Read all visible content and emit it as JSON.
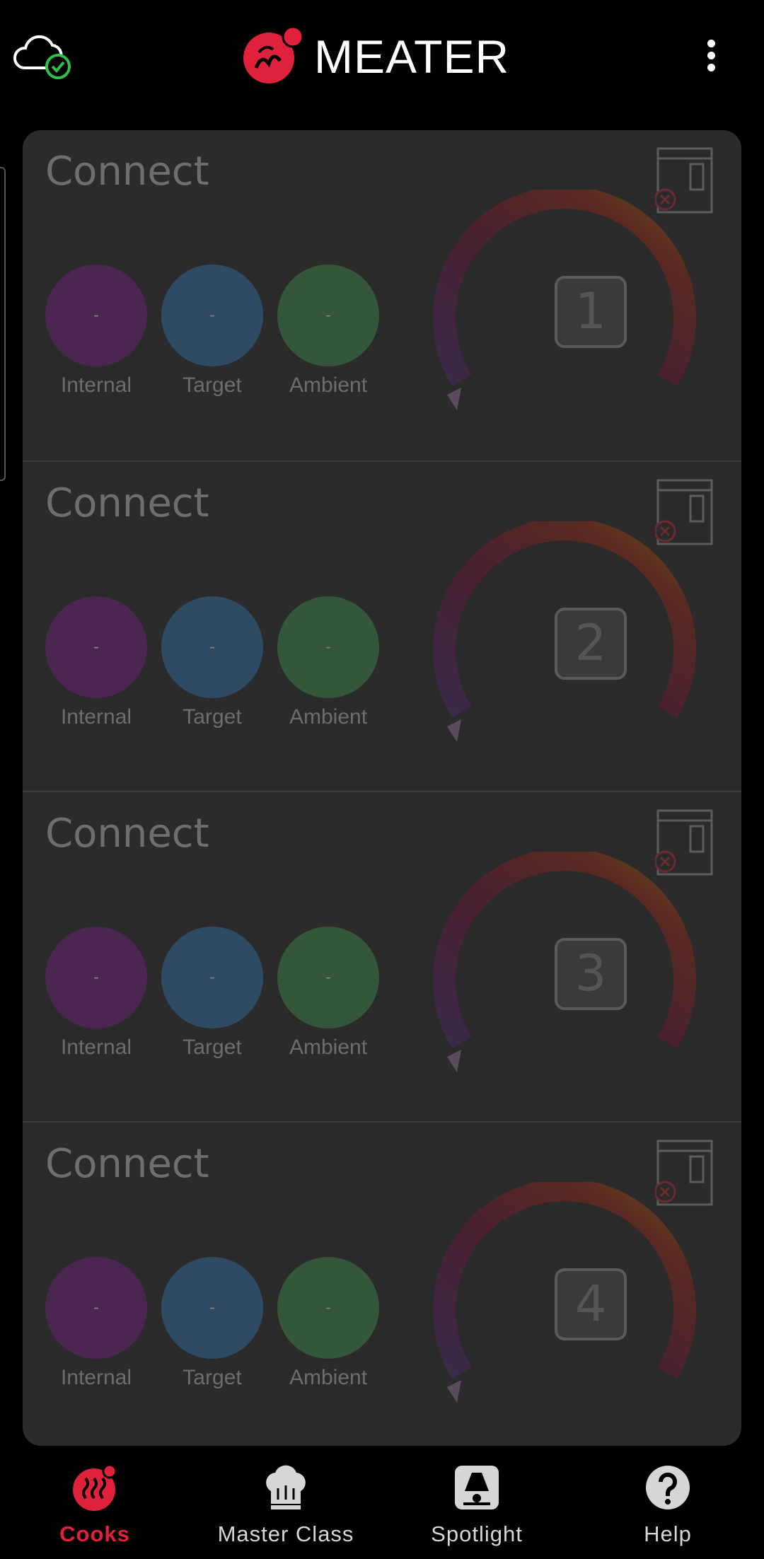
{
  "header": {
    "brand": "MEATER"
  },
  "cards": [
    {
      "title": "Connect",
      "probe": "1",
      "internal": "-",
      "target": "-",
      "ambient": "-",
      "labels": {
        "internal": "Internal",
        "target": "Target",
        "ambient": "Ambient"
      }
    },
    {
      "title": "Connect",
      "probe": "2",
      "internal": "-",
      "target": "-",
      "ambient": "-",
      "labels": {
        "internal": "Internal",
        "target": "Target",
        "ambient": "Ambient"
      }
    },
    {
      "title": "Connect",
      "probe": "3",
      "internal": "-",
      "target": "-",
      "ambient": "-",
      "labels": {
        "internal": "Internal",
        "target": "Target",
        "ambient": "Ambient"
      }
    },
    {
      "title": "Connect",
      "probe": "4",
      "internal": "-",
      "target": "-",
      "ambient": "-",
      "labels": {
        "internal": "Internal",
        "target": "Target",
        "ambient": "Ambient"
      }
    }
  ],
  "nav": [
    {
      "label": "Cooks",
      "icon": "cooks-icon",
      "active": true
    },
    {
      "label": "Master Class",
      "icon": "chef-hat-icon",
      "active": false
    },
    {
      "label": "Spotlight",
      "icon": "spotlight-icon",
      "active": false
    },
    {
      "label": "Help",
      "icon": "help-icon",
      "active": false
    }
  ],
  "colors": {
    "accent": "#e0213b",
    "cloud_ok": "#2fbf4a"
  }
}
